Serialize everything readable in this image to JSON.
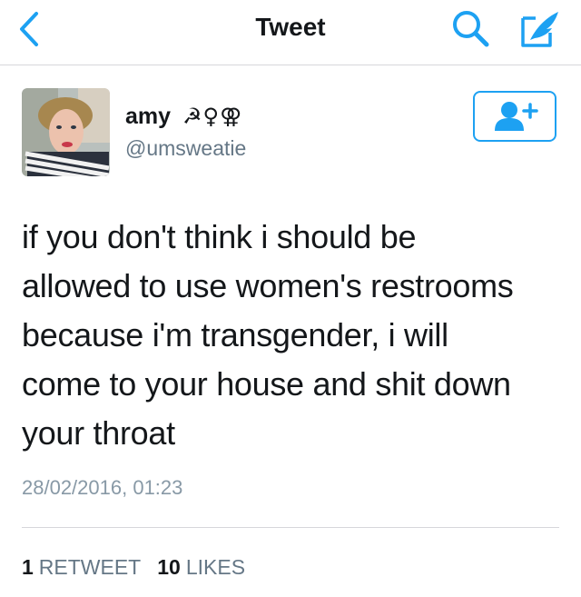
{
  "navbar": {
    "title": "Tweet",
    "back_icon": "chevron-left-icon",
    "search_icon": "search-icon",
    "compose_icon": "compose-quill-icon",
    "accent_color": "#1da1f2"
  },
  "tweet": {
    "author": {
      "display_name": "amy",
      "name_emoji": "☭♀⚢",
      "handle": "@umsweatie",
      "avatar_icon": "profile-photo"
    },
    "follow_icon": "add-user-icon",
    "text": "if you don't think i should be\nallowed to use women's restrooms\nbecause i'm transgender, i will\ncome to your house and shit down\nyour throat",
    "timestamp": "28/02/2016, 01:23",
    "stats": {
      "retweets_count": "1",
      "retweets_label": "RETWEET",
      "likes_count": "10",
      "likes_label": "LIKES"
    }
  }
}
